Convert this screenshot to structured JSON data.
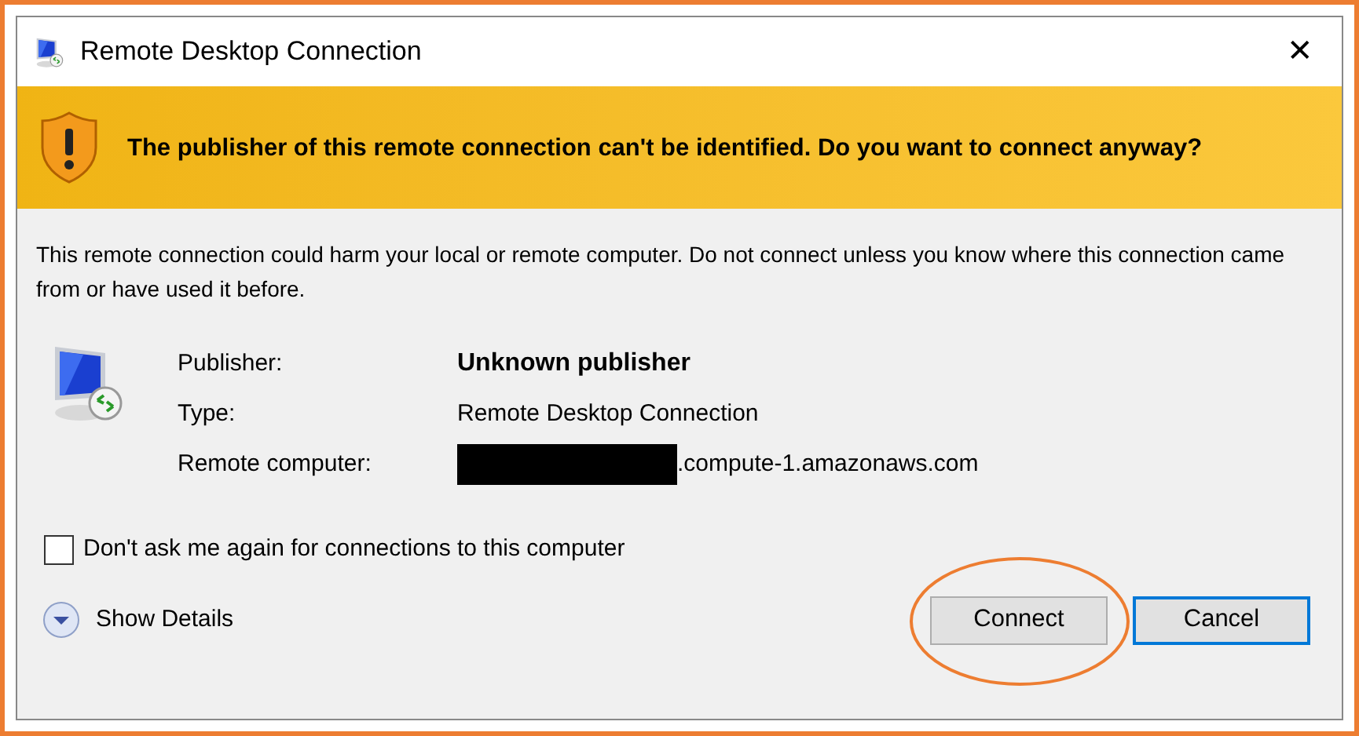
{
  "window": {
    "title": "Remote Desktop Connection",
    "close": "✕"
  },
  "warning": {
    "message": "The publisher of this remote connection can't be identified. Do you want to connect anyway?"
  },
  "description": "This remote connection could harm your local or remote computer. Do not connect unless you know where this connection came from or have used it before.",
  "details": [
    {
      "label": "Publisher:",
      "value": "Unknown publisher",
      "kind": "bold"
    },
    {
      "label": "Type:",
      "value": "Remote Desktop Connection",
      "kind": "plain"
    },
    {
      "label": "Remote computer:",
      "value": ".compute-1.amazonaws.com",
      "kind": "redacted"
    }
  ],
  "checkbox": {
    "label": "Don't ask me again for connections to this computer",
    "checked": false
  },
  "show_details": {
    "label": "Show Details",
    "expanded": false
  },
  "buttons": [
    {
      "label": "Connect",
      "default": false,
      "circled": true
    },
    {
      "label": "Cancel",
      "default": true,
      "circled": false
    }
  ]
}
